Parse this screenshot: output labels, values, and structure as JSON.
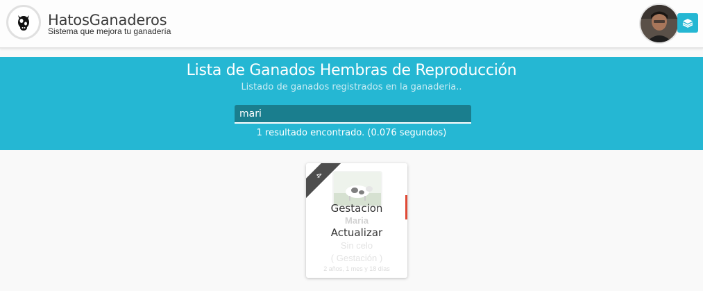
{
  "header": {
    "brand_title": "HatosGanaderos",
    "brand_subtitle": "Sistema que mejora tu ganadería",
    "logo_icon": "cow-icon",
    "avatar_icon": "user-avatar",
    "layers_icon": "layers-icon"
  },
  "banner": {
    "title": "Lista de Ganados Hembras de Reproducción",
    "subtitle": "Listado de ganados registrados en la ganaderia..",
    "search_value": "mari",
    "result_count": "1 resultado encontrado. (0.076 segundos)"
  },
  "cards": [
    {
      "ribbon_number": "4",
      "status": "Gestacion",
      "name": "Maria",
      "action": "Actualizar",
      "celo": "Sin celo",
      "phase": "( Gestación )",
      "age": "2 años, 1 mes y 18 días"
    }
  ],
  "colors": {
    "accent": "#25b7d3",
    "search_bg": "#1a7e8e",
    "side_bar": "#e04a36",
    "ribbon": "#4d4d4d"
  }
}
